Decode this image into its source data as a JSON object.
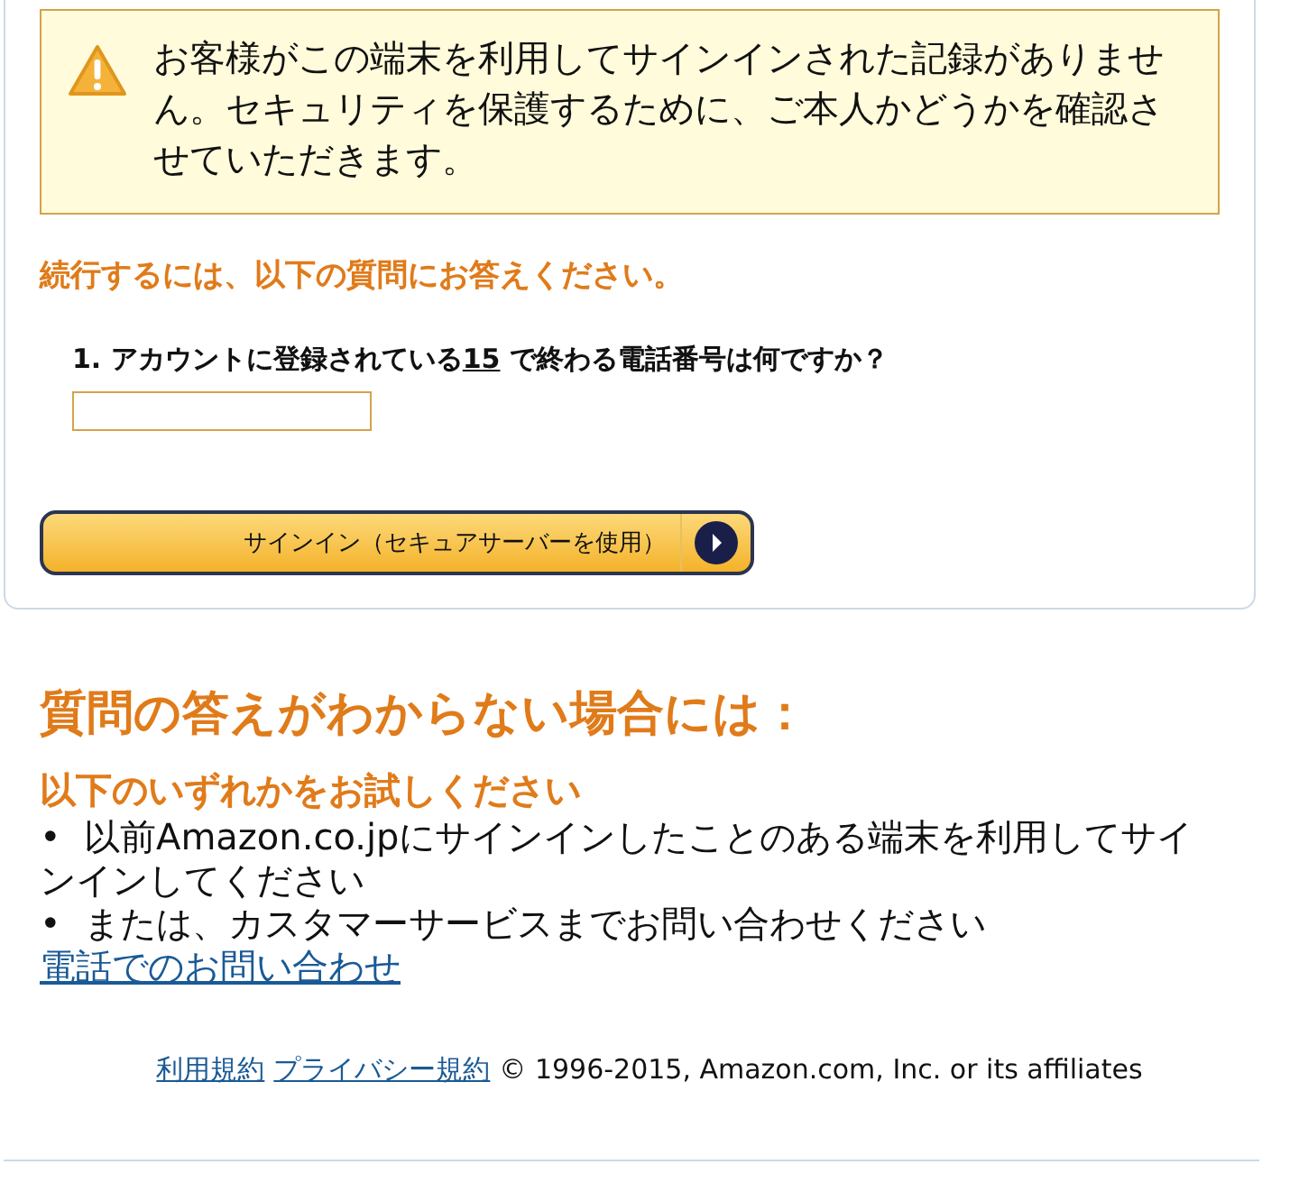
{
  "alert": {
    "message": "お客様がこの端末を利用してサインインされた記録がありません。セキュリティを保護するために、ご本人かどうかを確認させていただきます。"
  },
  "instruction": "続行するには、以下の質問にお答えください。",
  "question": {
    "before": "1. アカウントに登録されている",
    "digits": "15",
    "after": " で終わる電話番号は何ですか？"
  },
  "signin_button": {
    "label": "サインイン（セキュアサーバーを使用）"
  },
  "help": {
    "title": "質問の答えがわからない場合には：",
    "subtitle": "以下のいずれかをお試しください",
    "items": [
      {
        "bullet": "•",
        "text": "以前Amazon.co.jpにサインインしたことのある端末を利用してサインインしてください"
      },
      {
        "bullet": "•",
        "text": "または、カスタマーサービスまでお問い合わせください ",
        "link": "電話でのお問い合わせ"
      }
    ]
  },
  "footer": {
    "links": [
      "利用規約",
      "プライバシー規約"
    ],
    "copyright": "© 1996-2015, Amazon.com, Inc. or its affiliates"
  }
}
